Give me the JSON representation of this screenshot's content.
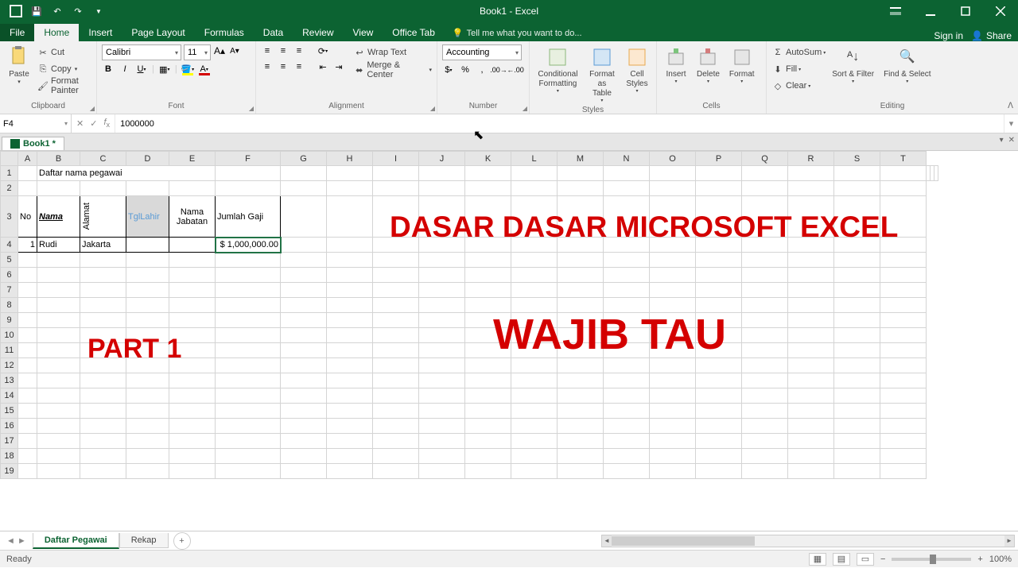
{
  "window": {
    "title": "Book1 - Excel"
  },
  "qat": {
    "save": "save",
    "undo": "undo",
    "redo": "redo",
    "touch": "touch"
  },
  "menu": {
    "file": "File",
    "home": "Home",
    "insert": "Insert",
    "pagelayout": "Page Layout",
    "formulas": "Formulas",
    "data": "Data",
    "review": "Review",
    "view": "View",
    "officetab": "Office Tab",
    "tellme": "Tell me what you want to do...",
    "signin": "Sign in",
    "share": "Share"
  },
  "ribbon": {
    "clipboard": {
      "label": "Clipboard",
      "paste": "Paste",
      "cut": "Cut",
      "copy": "Copy",
      "formatpainter": "Format Painter"
    },
    "font": {
      "label": "Font",
      "name": "Calibri",
      "size": "11"
    },
    "alignment": {
      "label": "Alignment",
      "wrap": "Wrap Text",
      "merge": "Merge & Center"
    },
    "number": {
      "label": "Number",
      "format": "Accounting"
    },
    "styles": {
      "label": "Styles",
      "conditional": "Conditional Formatting",
      "formatas": "Format as Table",
      "cellstyles": "Cell Styles"
    },
    "cells": {
      "label": "Cells",
      "insert": "Insert",
      "delete": "Delete",
      "format": "Format"
    },
    "editing": {
      "label": "Editing",
      "autosum": "AutoSum",
      "fill": "Fill",
      "clear": "Clear",
      "sort": "Sort & Filter",
      "find": "Find & Select"
    }
  },
  "formulabar": {
    "cellref": "F4",
    "value": "1000000"
  },
  "workbook_tab": "Book1 *",
  "columns": [
    "A",
    "B",
    "C",
    "D",
    "E",
    "F",
    "G",
    "H",
    "I",
    "J",
    "K",
    "L",
    "M",
    "N",
    "O",
    "P",
    "Q",
    "R",
    "S",
    "T"
  ],
  "rows": [
    "1",
    "2",
    "3",
    "4",
    "5",
    "6",
    "7",
    "8",
    "9",
    "10",
    "11",
    "12",
    "13",
    "14",
    "15",
    "16",
    "17",
    "18",
    "19"
  ],
  "spreadsheet": {
    "title_row": "Daftar nama pegawai",
    "headers": {
      "no": "No",
      "nama": "Nama",
      "alamat": "Alamat",
      "tgllahir": "TglLahir",
      "jabatan": "Nama Jabatan",
      "gaji": "Jumlah Gaji"
    },
    "data": {
      "no": "1",
      "nama": "Rudi",
      "alamat": "Jakarta",
      "tgllahir": "",
      "jabatan": "",
      "gaji": "$ 1,000,000.00"
    }
  },
  "overlays": {
    "part": "PART 1",
    "title_big": "DASAR DASAR MICROSOFT EXCEL",
    "subtitle": "WAJIB TAU"
  },
  "sheets": {
    "active": "Daftar Pegawai",
    "other": "Rekap"
  },
  "status": {
    "ready": "Ready",
    "zoom": "100%"
  }
}
